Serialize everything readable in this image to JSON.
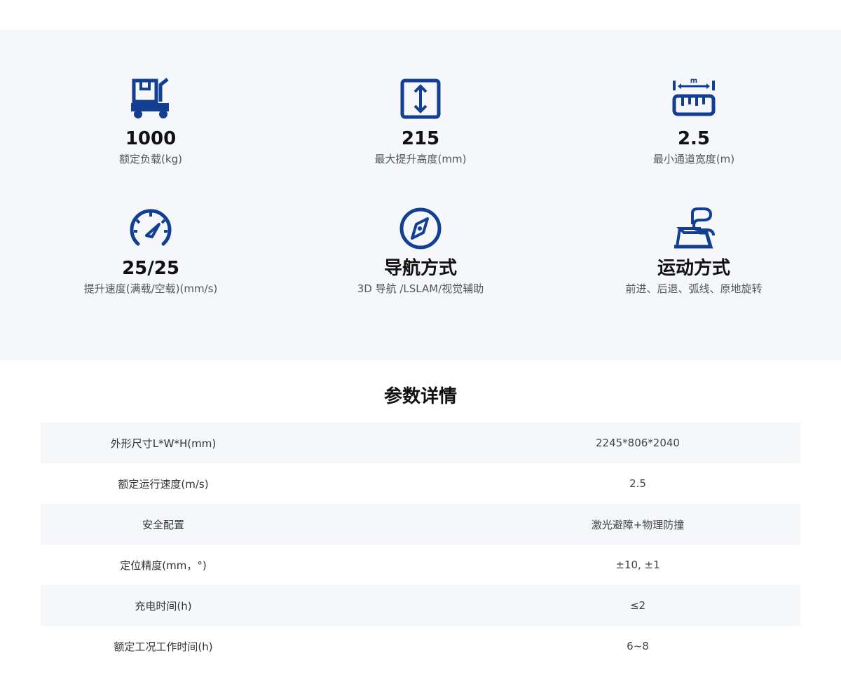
{
  "features": [
    {
      "icon": "agv-truck-icon",
      "value": "1000",
      "label": "额定负载(kg)"
    },
    {
      "icon": "vertical-arrow-icon",
      "value": "215",
      "label": "最大提升高度(mm)"
    },
    {
      "icon": "ruler-width-icon",
      "value": "2.5",
      "label": "最小通道宽度(m)",
      "icon_text": "m"
    },
    {
      "icon": "speedometer-icon",
      "value": "25/25",
      "label": "提升速度(满载/空载)(mm/s)"
    },
    {
      "icon": "compass-icon",
      "value": "导航方式",
      "label": "3D 导航 /LSLAM/视觉辅助"
    },
    {
      "icon": "motion-path-icon",
      "value": "运动方式",
      "label": "前进、后退、弧线、原地旋转"
    }
  ],
  "section_title": "参数详情",
  "specs": [
    {
      "key": "外形尺寸L*W*H(mm)",
      "value": "2245*806*2040"
    },
    {
      "key": "额定运行速度(m/s)",
      "value": "2.5"
    },
    {
      "key": "安全配置",
      "value": "激光避障+物理防撞"
    },
    {
      "key": "定位精度(mm，°)",
      "value": "±10, ±1"
    },
    {
      "key": "充电时间(h)",
      "value": "≤2"
    },
    {
      "key": "额定工况工作时间(h)",
      "value": "6~8"
    }
  ],
  "colors": {
    "accent": "#123f91",
    "panel_bg": "#f5f7fb",
    "row_alt": "#f5f7fb"
  }
}
